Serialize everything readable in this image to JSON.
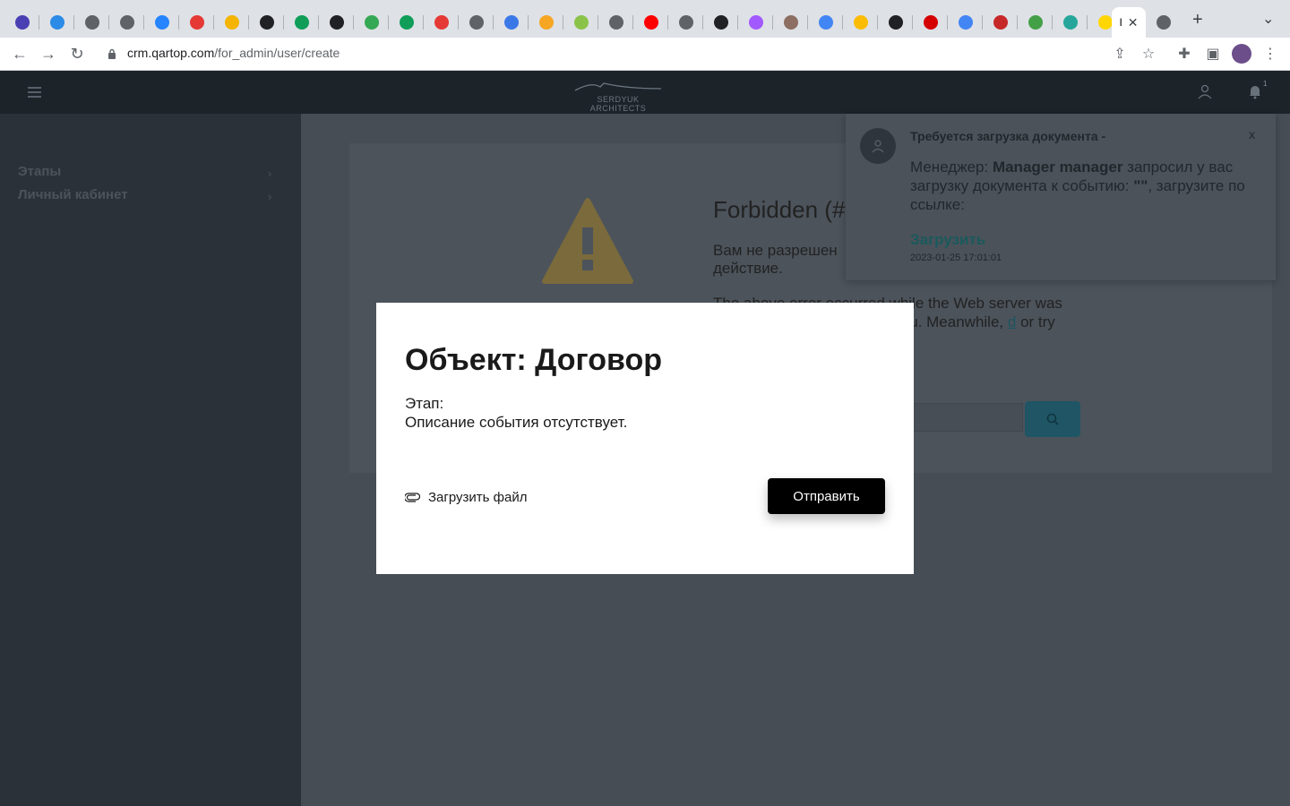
{
  "browser": {
    "url_host": "crm.qartop.com",
    "url_path": "/for_admin/user/create",
    "active_tab_label": "I",
    "tab_favicons": [
      "#4a3fb3",
      "#2b8be6",
      "#5f6368",
      "#5f6368",
      "#2684ff",
      "#e53935",
      "#f4b400",
      "#202124",
      "#0f9d58",
      "#202124",
      "#34a853",
      "#0f9d58",
      "#e53935",
      "#5f6368",
      "#3b78e7",
      "#f6a623",
      "#8bc34a",
      "#5f6368",
      "#ff0000",
      "#5f6368",
      "#202124",
      "#a259ff",
      "#8d6e63",
      "#4285f4",
      "#fbbc05",
      "#202124",
      "#d50000",
      "#4285f4",
      "#c62828",
      "#43a047",
      "#26a69a",
      "#ffd600"
    ]
  },
  "app": {
    "logo_text": "SERDYUK ARCHITECTS",
    "notifications_count": "1"
  },
  "sidebar": {
    "items": [
      {
        "label": "Этапы"
      },
      {
        "label": "Личный кабинет"
      }
    ]
  },
  "error_page": {
    "title": "Forbidden (#",
    "message": "Вам не разрешен действие.",
    "details_before": "The above error occurred while the Web server was ase contact us if you hank you. Meanwhile,",
    "details_link": "d",
    "details_after": "or try using the"
  },
  "notification": {
    "title": "Требуется загрузка документа -",
    "body_prefix": "Менеджер:",
    "manager_name": "Manager manager",
    "body_middle": "запросил у вас загрузку документа к событию:",
    "event_name": "\"\"",
    "body_suffix": ", загрузите по ссылке:",
    "link_label": "Загрузить",
    "timestamp": "2023-01-25 17:01:01",
    "close_label": "x"
  },
  "modal": {
    "title": "Объект: Договор",
    "stage_label": "Этап:",
    "description": "Описание события отсутствует.",
    "upload_label": "Загрузить файл",
    "submit_label": "Отправить"
  }
}
